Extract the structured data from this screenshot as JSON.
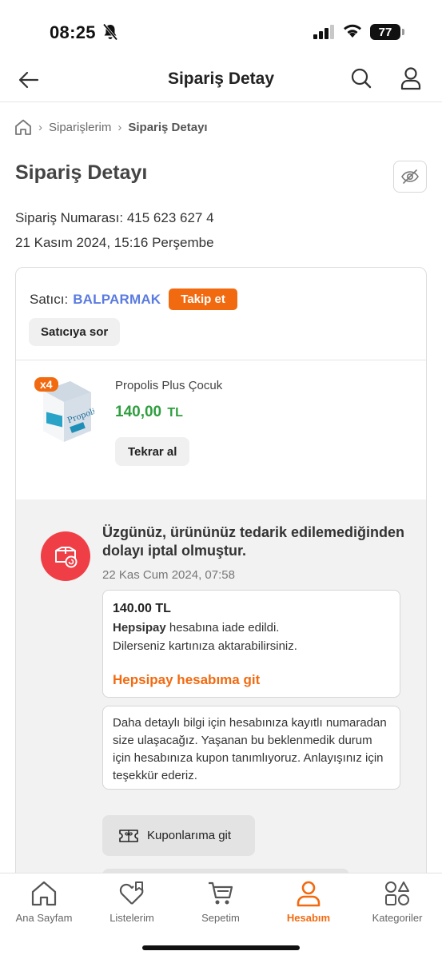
{
  "status_bar": {
    "time": "08:25",
    "battery": "77"
  },
  "header": {
    "title": "Sipariş Detay"
  },
  "breadcrumb": {
    "items": [
      "Siparişlerim",
      "Sipariş Detayı"
    ]
  },
  "page": {
    "title": "Sipariş Detayı",
    "order_number": "Sipariş Numarası: 415 623 627 4",
    "order_date": "21 Kasım 2024, 15:16 Perşembe"
  },
  "seller": {
    "label": "Satıcı:",
    "name": "BALPARMAK",
    "follow_label": "Takip et",
    "ask_label": "Satıcıya sor"
  },
  "product": {
    "quantity_badge": "x4",
    "name": "Propolis Plus Çocuk",
    "price": "140,00",
    "currency": "TL",
    "rebuy_label": "Tekrar al"
  },
  "cancellation": {
    "title": "Üzgünüz, ürününüz tedarik edilemediğinden dolayı iptal olmuştur.",
    "date": "22 Kas Cum 2024, 07:58",
    "refund": {
      "amount": "140.00 TL",
      "account_name": "Hepsipay",
      "line1_rest": " hesabına iade edildi.",
      "line2": "Dilerseniz kartınıza aktarabilirsiniz.",
      "link_label": "Hepsipay hesabıma git"
    },
    "info_text": "Daha detaylı bilgi için hesabınıza kayıtlı numaradan size ulaşacağız. Yaşanan bu beklenmedik durum için hesabınıza kupon tanımlıyoruz. Anlayışınız için teşekkür ederiz.",
    "coupons_label": "Kuponlarıma git"
  },
  "tab_bar": {
    "items": [
      {
        "label": "Ana Sayfam",
        "icon": "home-icon"
      },
      {
        "label": "Listelerim",
        "icon": "heart-list-icon"
      },
      {
        "label": "Sepetim",
        "icon": "cart-icon"
      },
      {
        "label": "Hesabım",
        "icon": "user-icon",
        "active": true
      },
      {
        "label": "Kategoriler",
        "icon": "categories-icon"
      }
    ]
  },
  "colors": {
    "accent": "#f26a10",
    "price_green": "#2e9e3f",
    "seller_blue": "#5a7be0",
    "cancel_red": "#f03e46"
  }
}
